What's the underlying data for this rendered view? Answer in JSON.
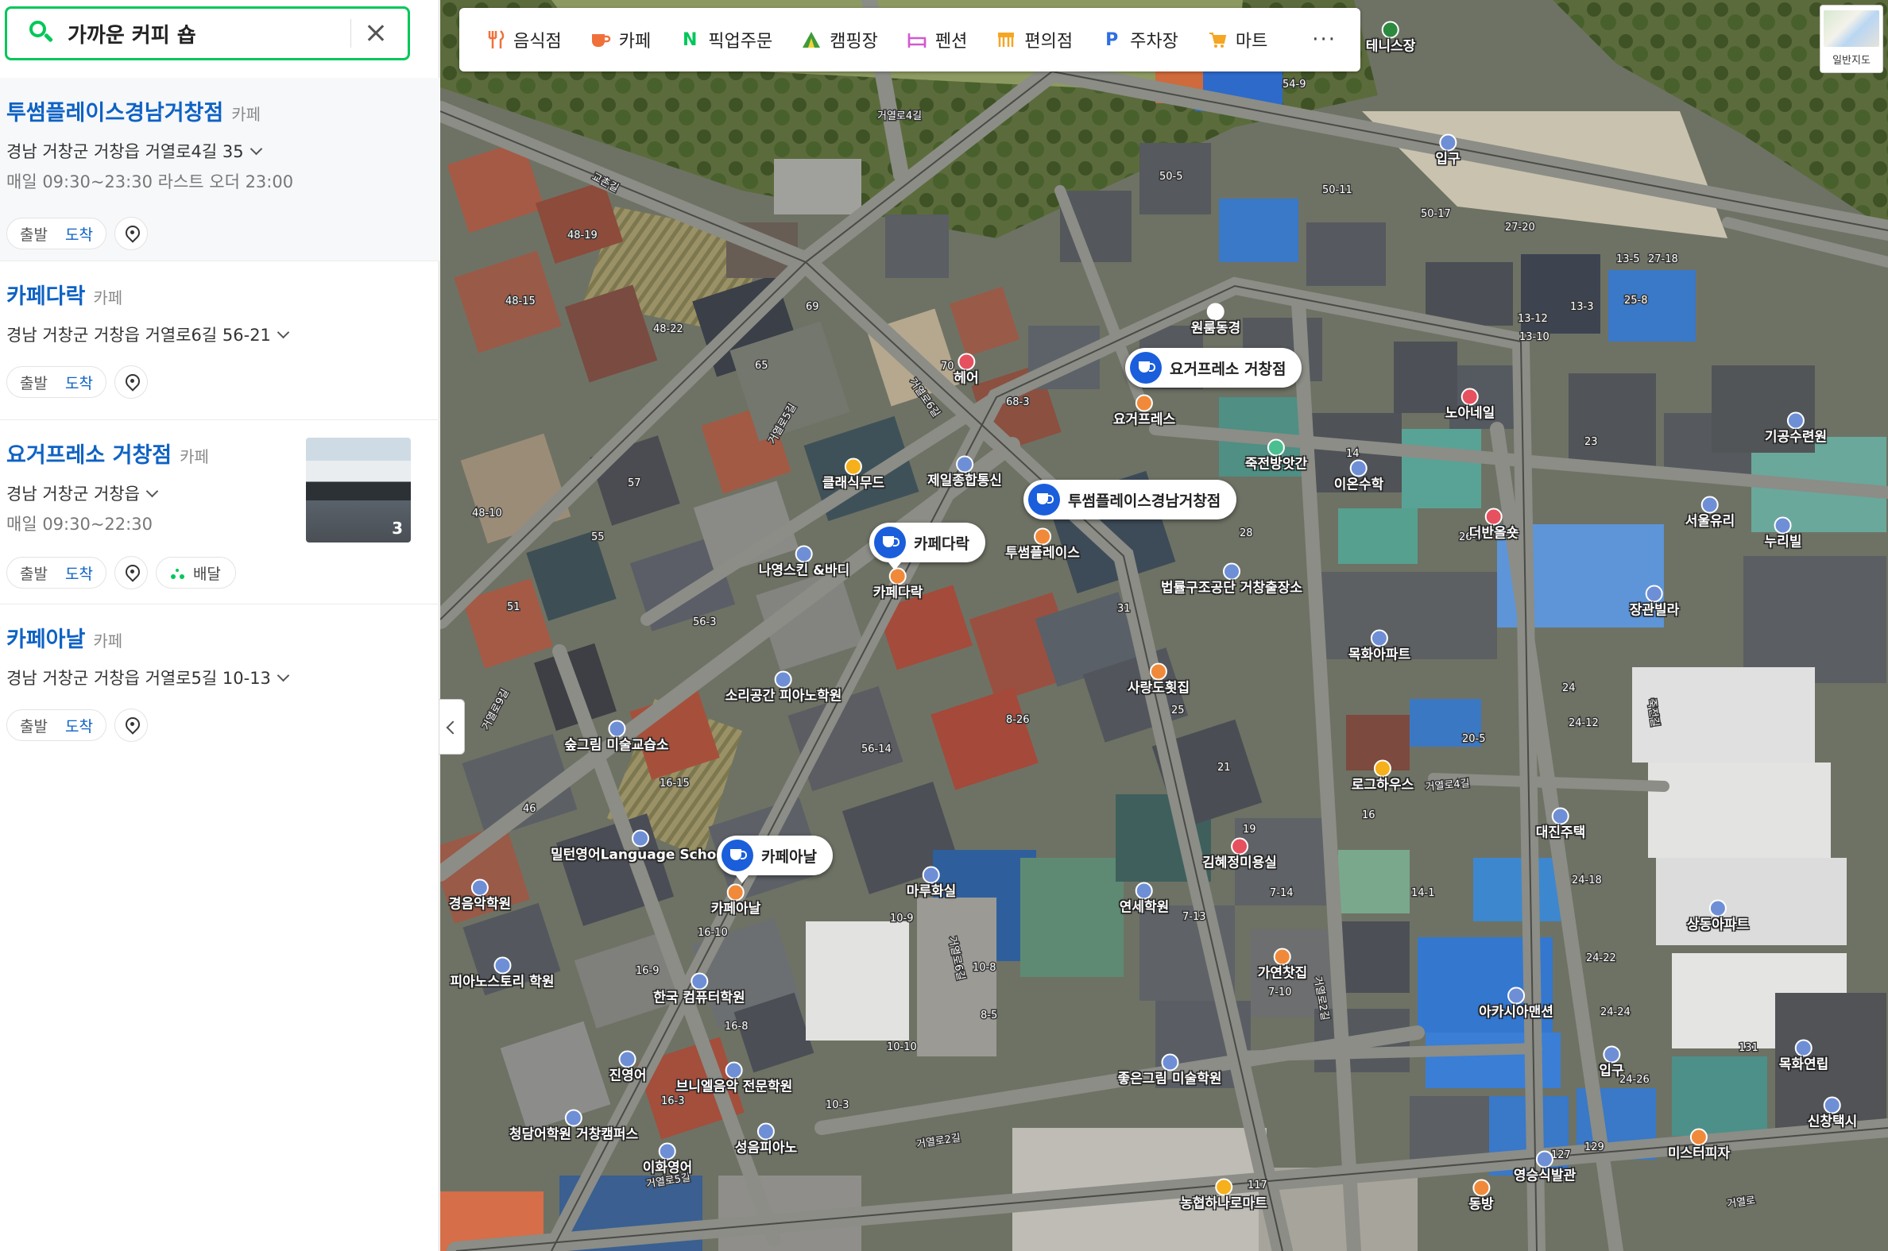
{
  "search": {
    "query": "가까운 커피 숍"
  },
  "results": [
    {
      "title": "투썸플레이스경남거창점",
      "category": "카페",
      "address": "경남 거창군 거창읍 거열로4길 35",
      "hours": "매일 09:30~23:30 라스트 오더 23:00",
      "departure": "출발",
      "arrival": "도착"
    },
    {
      "title": "카페다락",
      "category": "카페",
      "address": "경남 거창군 거창읍 거열로6길 56-21",
      "departure": "출발",
      "arrival": "도착"
    },
    {
      "title": "요거프레소 거창점",
      "category": "카페",
      "address": "경남 거창군 거창읍",
      "hours": "매일 09:30~22:30",
      "departure": "출발",
      "arrival": "도착",
      "delivery": "배달",
      "photo_count": "3"
    },
    {
      "title": "카페아날",
      "category": "카페",
      "address": "경남 거창군 거창읍 거열로5길 10-13",
      "departure": "출발",
      "arrival": "도착"
    }
  ],
  "categories": [
    {
      "label": "음식점",
      "icon": "fork-knife-icon",
      "color": "#f0703a"
    },
    {
      "label": "카페",
      "icon": "coffee-cup-icon",
      "color": "#f0703a"
    },
    {
      "label": "픽업주문",
      "icon": "naver-n-icon",
      "color": "#03c75a"
    },
    {
      "label": "캠핑장",
      "icon": "tent-icon",
      "color": "#3f9b3a"
    },
    {
      "label": "펜션",
      "icon": "bed-icon",
      "color": "#d05ad0"
    },
    {
      "label": "편의점",
      "icon": "store-icon",
      "color": "#f5a623"
    },
    {
      "label": "주차장",
      "icon": "parking-icon",
      "color": "#2f6fe0"
    },
    {
      "label": "마트",
      "icon": "cart-icon",
      "color": "#f5a623"
    }
  ],
  "map_type_label": "일반지도",
  "cafe_markers": [
    {
      "label": "요거프레소 거창점"
    },
    {
      "label": "투썸플레이스경남거창점"
    },
    {
      "label": "카페다락"
    },
    {
      "label": "카페아날"
    }
  ],
  "poi_labels": [
    {
      "text": "테니스장",
      "color": "#2c8a3f"
    },
    {
      "text": "입구",
      "color": "#6e8fd6"
    },
    {
      "text": "원룸동경",
      "color": "#ffffff"
    },
    {
      "text": "헤어",
      "color": "#e7505f"
    },
    {
      "text": "요거프레스",
      "color": "#f08a3a"
    },
    {
      "text": "제일종합통신",
      "color": "#6e8fd6"
    },
    {
      "text": "클래식무드",
      "color": "#f5b01b"
    },
    {
      "text": "나영스킨 &바디",
      "color": "#6e8fd6"
    },
    {
      "text": "카페다락",
      "color": "#f08a3a"
    },
    {
      "text": "투썸플레이스",
      "color": "#f08a3a"
    },
    {
      "text": "죽전방앗간",
      "color": "#4bbf8f"
    },
    {
      "text": "노아네일",
      "color": "#e7505f"
    },
    {
      "text": "이온수학",
      "color": "#6e8fd6"
    },
    {
      "text": "더반올숏",
      "color": "#e7505f"
    },
    {
      "text": "기공수련원",
      "color": "#6e8fd6"
    },
    {
      "text": "서울유리",
      "color": "#6e8fd6"
    },
    {
      "text": "누리빌",
      "color": "#6e8fd6"
    },
    {
      "text": "법률구조공단 거창출장소",
      "color": "#6e8fd6"
    },
    {
      "text": "장관빌라",
      "color": "#6e8fd6"
    },
    {
      "text": "목화아파트",
      "color": "#6e8fd6"
    },
    {
      "text": "사랑도횟집",
      "color": "#f08a3a"
    },
    {
      "text": "소리공간 피아노학원",
      "color": "#6e8fd6"
    },
    {
      "text": "숲그림 미술교습소",
      "color": "#6e8fd6"
    },
    {
      "text": "로그하우스",
      "color": "#f5b01b"
    },
    {
      "text": "대진주택",
      "color": "#6e8fd6"
    },
    {
      "text": "밀턴영어Language School",
      "color": "#6e8fd6"
    },
    {
      "text": "김혜정미용실",
      "color": "#e7505f"
    },
    {
      "text": "연세학원",
      "color": "#6e8fd6"
    },
    {
      "text": "마루화실",
      "color": "#6e8fd6"
    },
    {
      "text": "카페아날",
      "color": "#f08a3a"
    },
    {
      "text": "상동아파트",
      "color": "#6e8fd6"
    },
    {
      "text": "가연찻집",
      "color": "#f08a3a"
    },
    {
      "text": "피아노스토리 학원",
      "color": "#6e8fd6"
    },
    {
      "text": "한국 컴퓨터학원",
      "color": "#6e8fd6"
    },
    {
      "text": "아카시아맨션",
      "color": "#6e8fd6"
    },
    {
      "text": "진영어",
      "color": "#6e8fd6"
    },
    {
      "text": "브니엘음악 전문학원",
      "color": "#6e8fd6"
    },
    {
      "text": "좋은그림 미술학원",
      "color": "#6e8fd6"
    },
    {
      "text": "목화연립",
      "color": "#6e8fd6"
    },
    {
      "text": "청담어학원 거창캠퍼스",
      "color": "#6e8fd6"
    },
    {
      "text": "성음피아노",
      "color": "#6e8fd6"
    },
    {
      "text": "이화영어",
      "color": "#6e8fd6"
    },
    {
      "text": "미스터피자",
      "color": "#f08a3a"
    },
    {
      "text": "신창택시",
      "color": "#6e8fd6"
    },
    {
      "text": "영승식발관",
      "color": "#6e8fd6"
    },
    {
      "text": "농협하나로마트",
      "color": "#f5b01b"
    },
    {
      "text": "동방",
      "color": "#f08a3a"
    },
    {
      "text": "경음악학원",
      "color": "#6e8fd6"
    },
    {
      "text": "입구",
      "color": "#6e8fd6"
    }
  ],
  "road_labels": [
    "거열로4길",
    "교촌길",
    "거열로5길",
    "거열로6길",
    "거열로",
    "거열로2길",
    "거열로5길",
    "거열로9길",
    "거열로4길",
    "거열로6길",
    "죽전길",
    "거열로2길"
  ],
  "address_numbers": [
    "54-9",
    "50-5",
    "50-11",
    "50-17",
    "27-20",
    "27-18",
    "25-8",
    "23",
    "48-19",
    "48-15",
    "48-22",
    "69",
    "65",
    "70",
    "68-3",
    "57",
    "48-10",
    "55",
    "51",
    "56-3",
    "56-14",
    "46",
    "16-15",
    "16-10",
    "16-9",
    "16-8",
    "16-3",
    "10-3",
    "10-8",
    "10-9",
    "10-10",
    "8-26",
    "8-5",
    "31",
    "25",
    "21",
    "19",
    "14",
    "28",
    "26-9",
    "24",
    "24-12",
    "24-18",
    "24-22",
    "24-24",
    "24-26",
    "127",
    "129",
    "131",
    "117",
    "7-10",
    "7-14",
    "7-13",
    "16",
    "14-1",
    "20-5",
    "13-12",
    "13-10",
    "13-3",
    "13-5"
  ]
}
